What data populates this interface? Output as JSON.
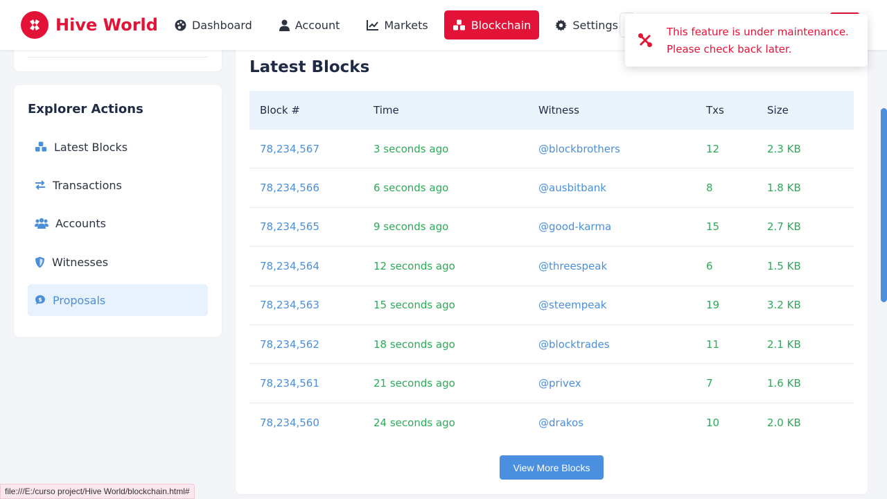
{
  "brand": {
    "name": "Hive World",
    "color": "#e31337"
  },
  "nav": [
    {
      "label": "Dashboard",
      "icon": "palette-icon"
    },
    {
      "label": "Account",
      "icon": "user-icon"
    },
    {
      "label": "Markets",
      "icon": "chart-line-icon"
    },
    {
      "label": "Blockchain",
      "icon": "cubes-icon",
      "active": true
    },
    {
      "label": "Settings",
      "icon": "gear-icon"
    }
  ],
  "toast": {
    "line1": "This feature is under maintenance.",
    "line2": "Please check back later.",
    "icon": "tools-icon"
  },
  "sidebar": {
    "title": "Explorer Actions",
    "items": [
      {
        "label": "Latest Blocks",
        "icon": "cubes-icon"
      },
      {
        "label": "Transactions",
        "icon": "exchange-icon"
      },
      {
        "label": "Accounts",
        "icon": "users-icon"
      },
      {
        "label": "Witnesses",
        "icon": "shield-icon"
      },
      {
        "label": "Proposals",
        "icon": "dollar-comment-icon",
        "active": true
      }
    ]
  },
  "main": {
    "title": "Latest Blocks",
    "columns": [
      "Block #",
      "Time",
      "Witness",
      "Txs",
      "Size"
    ],
    "rows": [
      [
        "78,234,567",
        "3 seconds ago",
        "@blockbrothers",
        "12",
        "2.3 KB"
      ],
      [
        "78,234,566",
        "6 seconds ago",
        "@ausbitbank",
        "8",
        "1.8 KB"
      ],
      [
        "78,234,565",
        "9 seconds ago",
        "@good-karma",
        "15",
        "2.7 KB"
      ],
      [
        "78,234,564",
        "12 seconds ago",
        "@threespeak",
        "6",
        "1.5 KB"
      ],
      [
        "78,234,563",
        "15 seconds ago",
        "@steempeak",
        "19",
        "3.2 KB"
      ],
      [
        "78,234,562",
        "18 seconds ago",
        "@blocktrades",
        "11",
        "2.1 KB"
      ],
      [
        "78,234,561",
        "21 seconds ago",
        "@privex",
        "7",
        "1.6 KB"
      ],
      [
        "78,234,560",
        "24 seconds ago",
        "@drakos",
        "10",
        "2.0 KB"
      ]
    ],
    "more_label": "View More Blocks"
  },
  "status_url": "file:///E:/curso project/Hive World/blockchain.html#",
  "colors": {
    "accent": "#e31337",
    "link": "#4a8fd8",
    "value_green": "#2daa58",
    "header_bg": "#eaf3fc"
  }
}
